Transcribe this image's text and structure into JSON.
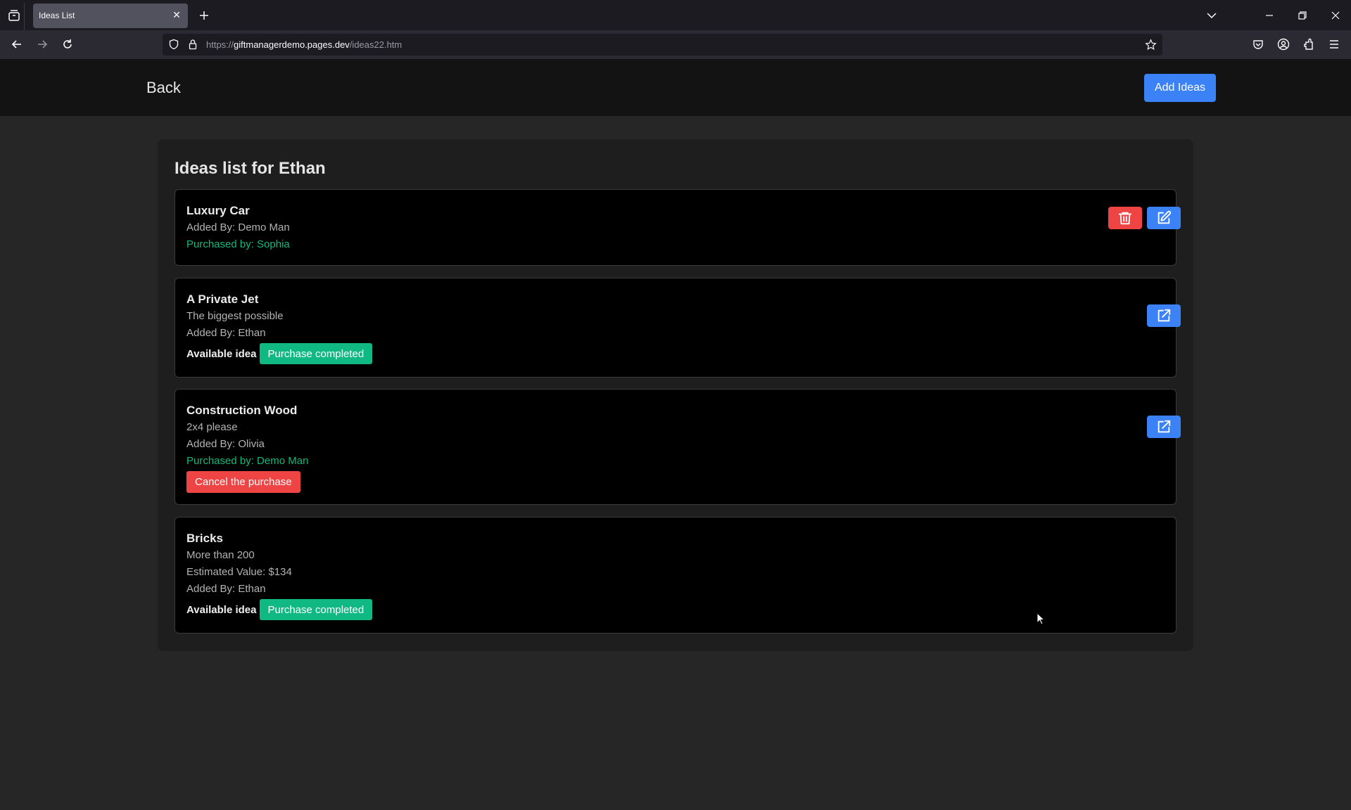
{
  "browser": {
    "tab_title": "Ideas List",
    "url_prefix": "https://",
    "url_host": "giftmanagerdemo.pages.dev",
    "url_path": "/ideas22.htm"
  },
  "header": {
    "back_label": "Back",
    "add_ideas_label": "Add Ideas"
  },
  "list": {
    "title": "Ideas list for Ethan",
    "cards": [
      {
        "name": "Luxury Car",
        "added_by": "Added By: Demo Man",
        "purchased_by": "Purchased by: Sophia"
      },
      {
        "name": "A Private Jet",
        "description": "The biggest possible",
        "added_by": "Added By: Ethan",
        "available_label": "Available idea",
        "purchase_button": "Purchase completed"
      },
      {
        "name": "Construction Wood",
        "description": "2x4 please",
        "added_by": "Added By: Olivia",
        "purchased_by": "Purchased by: Demo Man",
        "cancel_button": "Cancel the purchase"
      },
      {
        "name": "Bricks",
        "description": "More than 200",
        "estimated_value": "Estimated Value: $134",
        "added_by": "Added By: Ethan",
        "available_label": "Available idea",
        "purchase_button": "Purchase completed"
      }
    ]
  },
  "colors": {
    "primary": "#3b82f6",
    "danger": "#ef4444",
    "success": "#10b981"
  }
}
